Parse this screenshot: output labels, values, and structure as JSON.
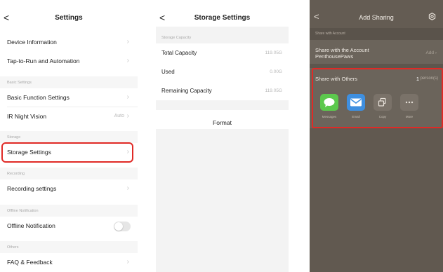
{
  "settings": {
    "back_glyph": "<",
    "title": "Settings",
    "rows": {
      "device_info": "Device Information",
      "tap_to_run": "Tap-to-Run and Automation",
      "basic_function": "Basic Function Settings",
      "ir_night_vision": "IR Night Vision",
      "ir_night_vision_value": "Auto",
      "storage_settings": "Storage Settings",
      "recording_settings": "Recording settings",
      "offline_notification": "Offline Notification",
      "faq": "FAQ & Feedback"
    },
    "sections": {
      "basic": "Basic Settings",
      "storage": "Storage",
      "recording": "Recording",
      "offline": "Offline Notification",
      "others": "Others"
    },
    "offline_toggle_on": false,
    "highlight_color": "#e02a26"
  },
  "storage": {
    "back_glyph": "<",
    "title": "Storage Settings",
    "section": "Storage Capacity",
    "rows": [
      {
        "label": "Total Capacity",
        "value": "119.05G"
      },
      {
        "label": "Used",
        "value": "0.00G"
      },
      {
        "label": "Remaining Capacity",
        "value": "119.05G"
      }
    ],
    "format_label": "Format"
  },
  "sharing": {
    "back_glyph": "<",
    "title": "Add Sharing",
    "section": "Share with Account",
    "account_line1": "Share with the Account",
    "account_line2": "PenthousePaws",
    "add_label": "Add",
    "share_others_label": "Share with Others",
    "person_count": "1",
    "person_unit": "person(s)",
    "apps": [
      {
        "label": "Messages",
        "icon": "messages-icon",
        "color": "#5cc84d"
      },
      {
        "label": "Email",
        "icon": "email-icon",
        "color": "#3e8fe0"
      },
      {
        "label": "Copy",
        "icon": "copy-icon",
        "color": "#7a7269"
      },
      {
        "label": "More",
        "icon": "more-icon",
        "color": "#7a7269"
      }
    ],
    "background_color": "#615950",
    "highlight_color": "#e02a26"
  }
}
